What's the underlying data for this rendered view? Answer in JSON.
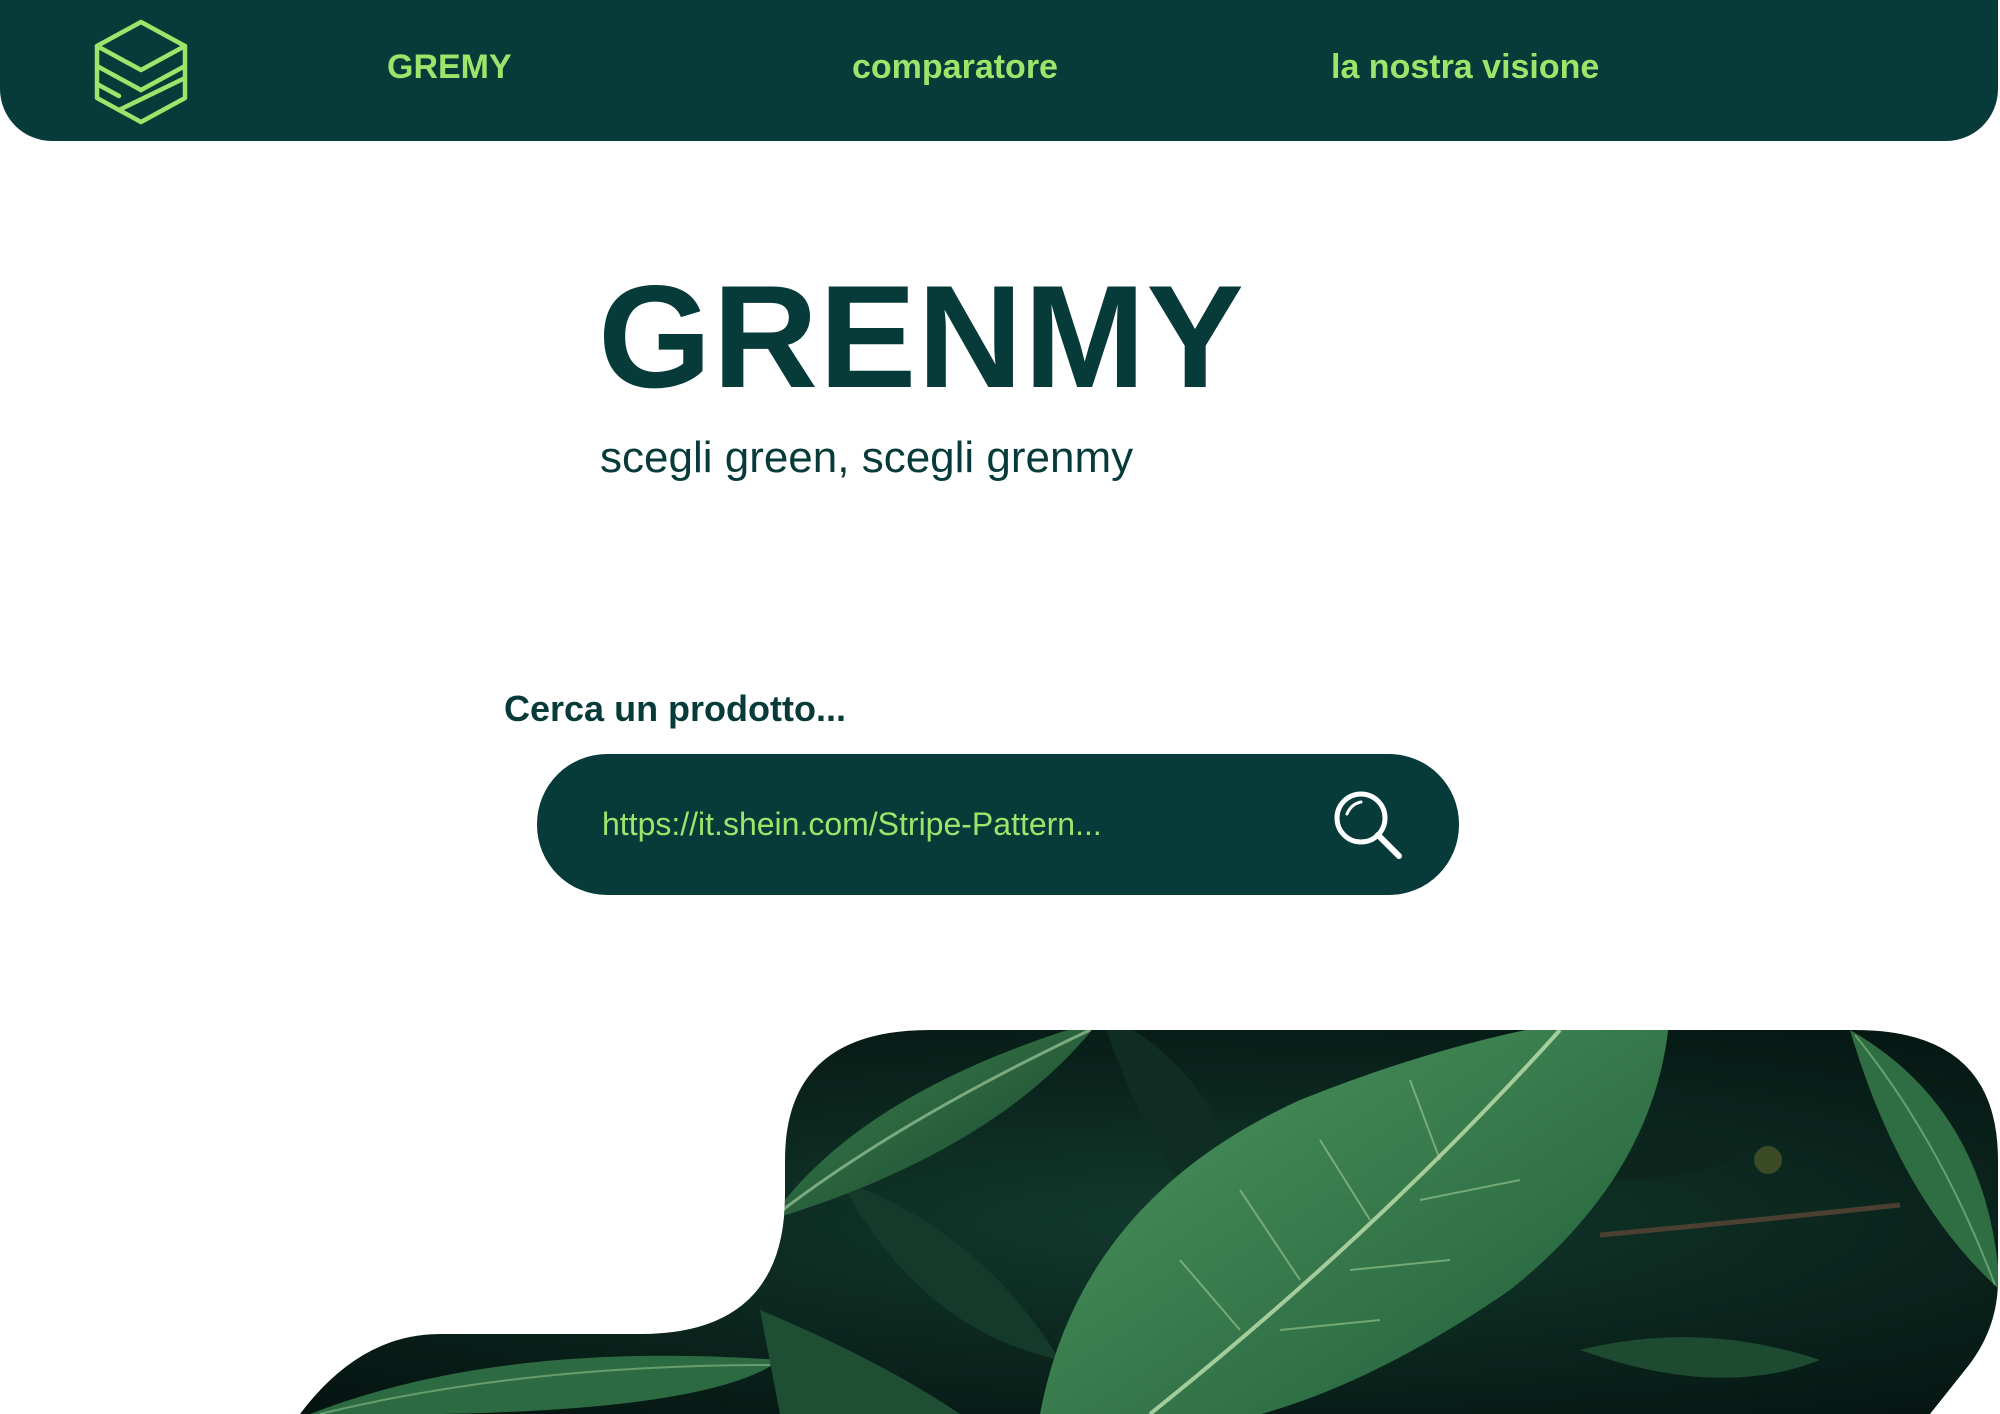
{
  "nav": {
    "brand": "GREMY",
    "comparatore": "comparatore",
    "visione": "la nostra visione"
  },
  "hero": {
    "title": "GRENMY",
    "subtitle": "scegli green, scegli grenmy"
  },
  "search": {
    "label": "Cerca un prodotto...",
    "value": "https://it.shein.com/Stripe-Pattern..."
  },
  "colors": {
    "primary": "#073b3a",
    "accent": "#9ee36a",
    "background": "#ffffff"
  },
  "icons": {
    "logo": "hexagon-cube-logo",
    "search": "search-icon"
  }
}
